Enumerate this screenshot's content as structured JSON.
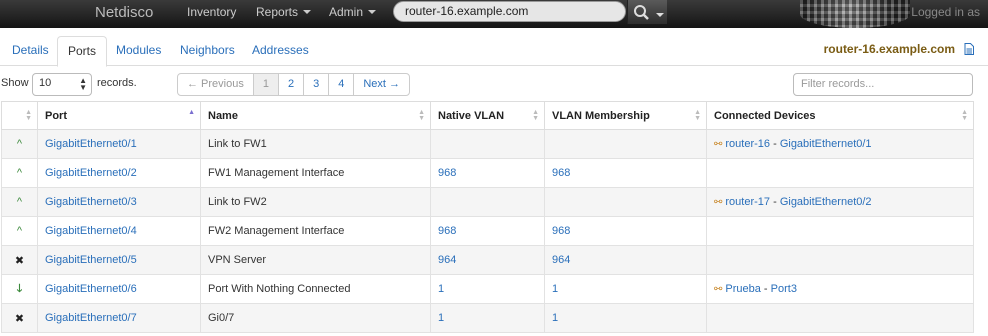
{
  "navbar": {
    "brand": "Netdisco",
    "items": [
      {
        "label": "Inventory",
        "dropdown": false
      },
      {
        "label": "Reports",
        "dropdown": true
      },
      {
        "label": "Admin",
        "dropdown": true
      }
    ],
    "search_value": "router-16.example.com",
    "login_text": "Logged in as"
  },
  "tabs": [
    "Details",
    "Ports",
    "Modules",
    "Neighbors",
    "Addresses"
  ],
  "active_tab": "Ports",
  "device_title": "router-16.example.com",
  "controls": {
    "show_label": "Show",
    "page_size": "10",
    "records_label": "records.",
    "previous": "← Previous",
    "pages": [
      "1",
      "2",
      "3",
      "4"
    ],
    "next": "Next →",
    "filter_placeholder": "Filter records..."
  },
  "table": {
    "columns": [
      "Port",
      "Name",
      "Native VLAN",
      "VLAN Membership",
      "Connected Devices"
    ],
    "rows": [
      {
        "status": "up",
        "status_glyph": "^",
        "port": "GigabitEthernet0/1",
        "name": "Link to FW1",
        "native_vlan": "",
        "vlan_membership": "",
        "device": "router-16",
        "separator": " - ",
        "device_port": "GigabitEthernet0/1"
      },
      {
        "status": "up",
        "status_glyph": "^",
        "port": "GigabitEthernet0/2",
        "name": "FW1 Management Interface",
        "native_vlan": "968",
        "vlan_membership": "968",
        "device": "",
        "separator": "",
        "device_port": ""
      },
      {
        "status": "up",
        "status_glyph": "^",
        "port": "GigabitEthernet0/3",
        "name": "Link to FW2",
        "native_vlan": "",
        "vlan_membership": "",
        "device": "router-17",
        "separator": " - ",
        "device_port": "GigabitEthernet0/2"
      },
      {
        "status": "up",
        "status_glyph": "^",
        "port": "GigabitEthernet0/4",
        "name": "FW2 Management Interface",
        "native_vlan": "968",
        "vlan_membership": "968",
        "device": "",
        "separator": "",
        "device_port": ""
      },
      {
        "status": "disabled",
        "status_glyph": "✖",
        "port": "GigabitEthernet0/5",
        "name": "VPN Server",
        "native_vlan": "964",
        "vlan_membership": "964",
        "device": "",
        "separator": "",
        "device_port": ""
      },
      {
        "status": "down",
        "status_glyph": "🡓",
        "port": "GigabitEthernet0/6",
        "name": "Port With Nothing Connected",
        "native_vlan": "1",
        "vlan_membership": "1",
        "device": "Prueba",
        "separator": " - ",
        "device_port": "Port3"
      },
      {
        "status": "disabled",
        "status_glyph": "✖",
        "port": "GigabitEthernet0/7",
        "name": "Gi0/7",
        "native_vlan": "1",
        "vlan_membership": "1",
        "device": "",
        "separator": "",
        "device_port": ""
      }
    ]
  },
  "colors": {
    "link": "#2a6fba",
    "title": "#7a5c14",
    "status_up": "#3c8a3c"
  }
}
